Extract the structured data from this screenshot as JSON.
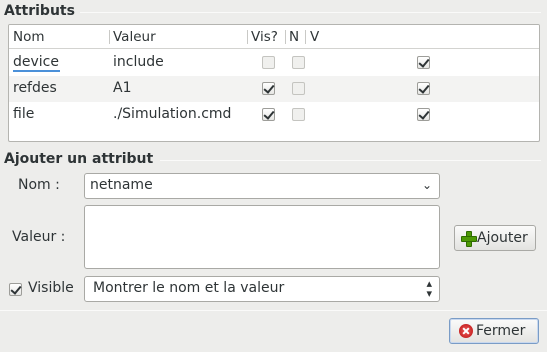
{
  "attributes_section": {
    "title": "Attributs"
  },
  "table": {
    "columns": [
      "Nom",
      "Valeur",
      "Vis?",
      "N",
      "V"
    ],
    "rows": [
      {
        "name": "device",
        "value": "include",
        "visible": false,
        "show_name": false,
        "show_value": true
      },
      {
        "name": "refdes",
        "value": "A1",
        "visible": true,
        "show_name": false,
        "show_value": true
      },
      {
        "name": "file",
        "value": "./Simulation.cmd",
        "visible": true,
        "show_name": false,
        "show_value": true
      }
    ]
  },
  "add_section": {
    "title": "Ajouter un attribut",
    "name_label": "Nom :",
    "name_value": "netname",
    "value_label": "Valeur :",
    "value_text": "",
    "add_button": "Ajouter",
    "visible_label": "Visible",
    "visible_checked": true,
    "display_mode": "Montrer le nom et la valeur"
  },
  "footer": {
    "close_button": "Fermer"
  },
  "icons": {
    "add": "add-icon",
    "close": "cancel-icon",
    "dropdown": "chevron-down-icon",
    "spinner": "up-down-arrows-icon"
  },
  "colors": {
    "window_bg": "#ededeb",
    "table_bg": "#ffffff",
    "alt_row": "#f3f3f2",
    "focus": "#7a9cc6"
  }
}
